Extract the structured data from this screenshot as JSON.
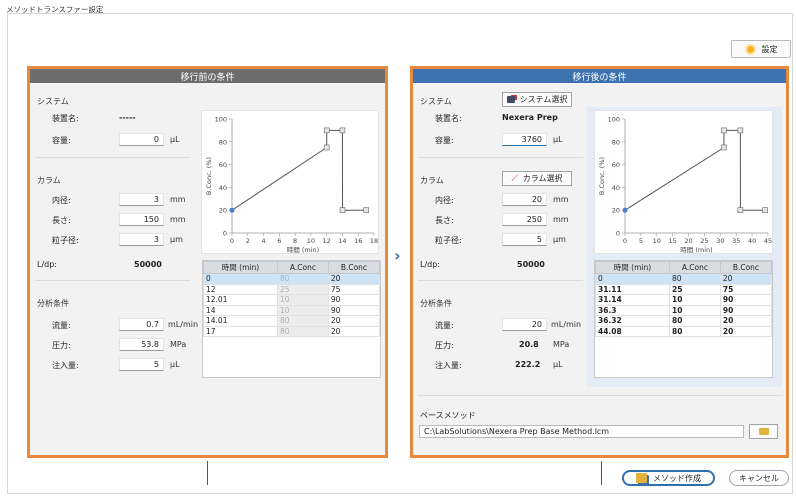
{
  "window": {
    "title": "メソッドトランスファー設定"
  },
  "settings_label": "設定",
  "left": {
    "header": "移行前の条件",
    "system_label": "システム",
    "device_label": "装置名:",
    "device_value": "-----",
    "volume_label": "容量:",
    "volume_value": "0",
    "volume_unit": "μL",
    "column_label": "カラム",
    "id_label": "内径:",
    "id_value": "3",
    "id_unit": "mm",
    "len_label": "長さ:",
    "len_value": "150",
    "len_unit": "mm",
    "ps_label": "粒子径:",
    "ps_value": "3",
    "ps_unit": "μm",
    "ldp_label": "L/dp:",
    "ldp_value": "50000",
    "cond_label": "分析条件",
    "flow_label": "流量:",
    "flow_value": "0.7",
    "flow_unit": "mL/min",
    "press_label": "圧力:",
    "press_value": "53.8",
    "press_unit": "MPa",
    "inj_label": "注入量:",
    "inj_value": "5",
    "inj_unit": "μL",
    "table": {
      "headers": [
        "時間 (min)",
        "A.Conc",
        "B.Conc"
      ],
      "rows": [
        [
          "0",
          "80",
          "20"
        ],
        [
          "12",
          "25",
          "75"
        ],
        [
          "12.01",
          "10",
          "90"
        ],
        [
          "14",
          "10",
          "90"
        ],
        [
          "14.01",
          "80",
          "20"
        ],
        [
          "17",
          "80",
          "20"
        ]
      ]
    }
  },
  "right": {
    "header": "移行後の条件",
    "system_label": "システム",
    "system_btn": "システム選択",
    "device_label": "装置名:",
    "device_value": "Nexera Prep",
    "volume_label": "容量:",
    "volume_value": "3760",
    "volume_unit": "μL",
    "column_label": "カラム",
    "column_btn": "カラム選択",
    "id_label": "内径:",
    "id_value": "20",
    "id_unit": "mm",
    "len_label": "長さ:",
    "len_value": "250",
    "len_unit": "mm",
    "ps_label": "粒子径:",
    "ps_value": "5",
    "ps_unit": "μm",
    "ldp_label": "L/dp:",
    "ldp_value": "50000",
    "cond_label": "分析条件",
    "flow_label": "流量:",
    "flow_value": "20",
    "flow_unit": "mL/min",
    "press_label": "圧力:",
    "press_value": "20.8",
    "press_unit": "MPa",
    "inj_label": "注入量:",
    "inj_value": "222.2",
    "inj_unit": "μL",
    "table": {
      "headers": [
        "時間 (min)",
        "A.Conc",
        "B.Conc"
      ],
      "rows": [
        [
          "0",
          "80",
          "20"
        ],
        [
          "31.11",
          "25",
          "75"
        ],
        [
          "31.14",
          "10",
          "90"
        ],
        [
          "36.3",
          "10",
          "90"
        ],
        [
          "36.32",
          "80",
          "20"
        ],
        [
          "44.08",
          "80",
          "20"
        ]
      ]
    },
    "base_label": "ベースメソッド",
    "base_path": "C:\\LabSolutions\\Nexera Prep Base Method.lcm"
  },
  "footer": {
    "create_btn": "メソッド作成",
    "cancel_btn": "キャンセル"
  },
  "chart_data": [
    {
      "type": "line",
      "xlabel": "時間 (min)",
      "ylabel": "B.Conc. (%)",
      "xlim": [
        0,
        18
      ],
      "ylim": [
        0,
        100
      ],
      "xticks": [
        0,
        2,
        4,
        6,
        8,
        10,
        12,
        14,
        16,
        18
      ],
      "yticks": [
        0,
        20,
        40,
        60,
        80,
        100
      ],
      "x": [
        0,
        12,
        12.01,
        14,
        14.01,
        17
      ],
      "y": [
        20,
        75,
        90,
        90,
        20,
        20
      ]
    },
    {
      "type": "line",
      "xlabel": "時間 (min)",
      "ylabel": "B.Conc. (%)",
      "xlim": [
        0,
        45
      ],
      "ylim": [
        0,
        100
      ],
      "xticks": [
        0,
        5,
        10,
        15,
        20,
        25,
        30,
        35,
        40,
        45
      ],
      "yticks": [
        0,
        20,
        40,
        60,
        80,
        100
      ],
      "x": [
        0,
        31.11,
        31.14,
        36.3,
        36.32,
        44.08
      ],
      "y": [
        20,
        75,
        90,
        90,
        20,
        20
      ]
    }
  ],
  "colors": {
    "panel_border": "#e78a3e",
    "left_header": "#6d6d6d",
    "right_header": "#3c72b0",
    "selected_row": "#cfe3f7"
  }
}
